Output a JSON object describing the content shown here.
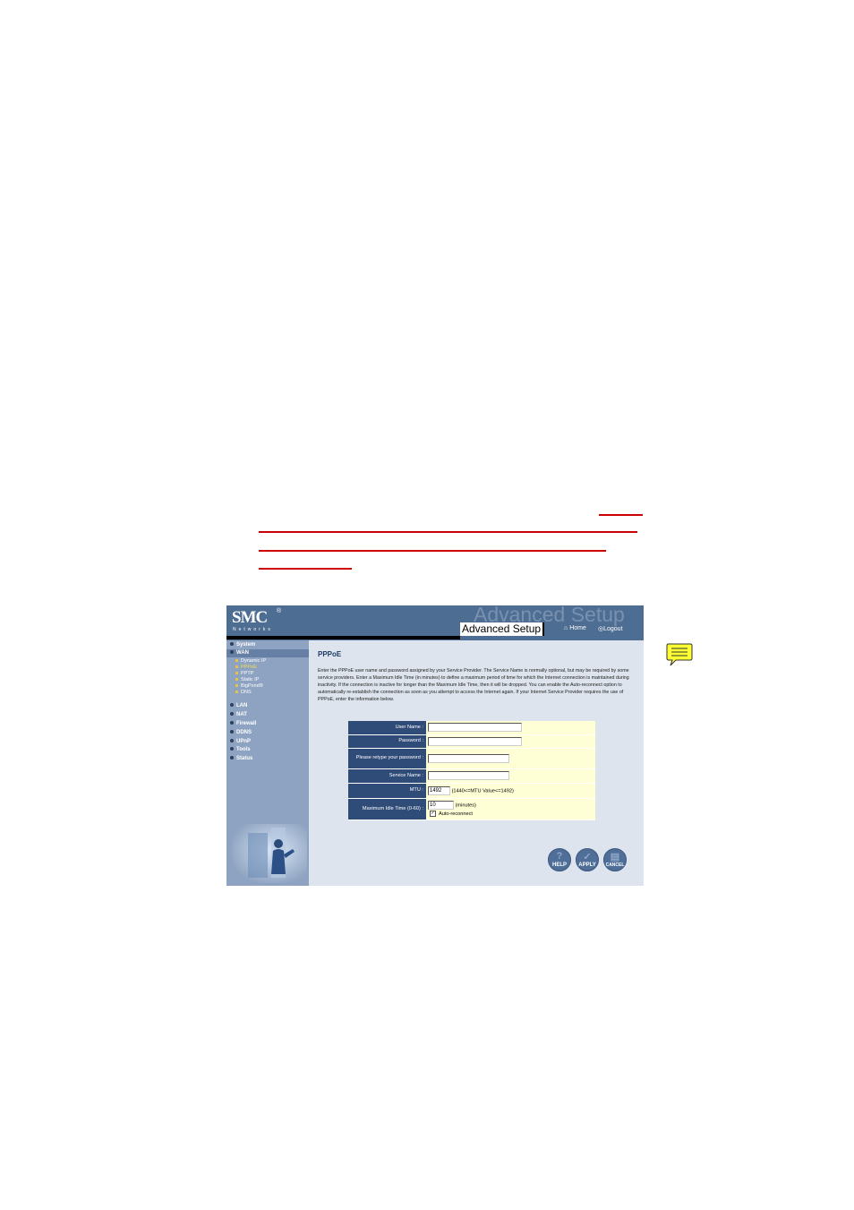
{
  "header": {
    "logo": "SMC",
    "logo_reg": "®",
    "logo_sub": "Networks",
    "watermark": "Advanced Setup",
    "tab_title": "Advanced Setup",
    "home": "Home",
    "logout": "Logout"
  },
  "sidebar": {
    "items": [
      {
        "label": "System"
      },
      {
        "label": "WAN"
      },
      {
        "label": "LAN"
      },
      {
        "label": "NAT"
      },
      {
        "label": "Firewall"
      },
      {
        "label": "DDNS"
      },
      {
        "label": "UPnP"
      },
      {
        "label": "Tools"
      },
      {
        "label": "Status"
      }
    ],
    "wan_sub": [
      {
        "label": "Dynamic IP"
      },
      {
        "label": "PPPoE"
      },
      {
        "label": "PPTP"
      },
      {
        "label": "Static IP"
      },
      {
        "label": "BigPond®"
      },
      {
        "label": "DNS"
      }
    ]
  },
  "main": {
    "title": "PPPoE",
    "description": "Enter the PPPoE user name and password assigned by your Service Provider. The Service Name is normally optional, but may be required by some service providers. Enter a Maximum Idle Time (in minutes) to define a maximum period of time for which the Internet connection is maintained during inactivity. If the connection is inactive for longer than the Maximum Idle Time, then it will be dropped. You can enable the Auto-reconnect option to automatically re-establish the connection as soon as you attempt to access the Internet again. If your Internet Service Provider requires the use of PPPoE, enter the information below.",
    "form": {
      "user_name_label": "User Name :",
      "user_name_value": "",
      "password_label": "Password :",
      "password_value": "",
      "retype_label": "Please retype your password :",
      "retype_value": "",
      "service_label": "Service Name :",
      "service_value": "",
      "mtu_label": "MTU :",
      "mtu_value": "1492",
      "mtu_hint": "(1440<=MTU Value<=1492)",
      "idle_label": "Maximum Idle Time (0-60) :",
      "idle_value": "10",
      "idle_unit": "(minutes)",
      "auto_check": "✓",
      "auto_label": "Auto-reconnect"
    },
    "buttons": {
      "help": "HELP",
      "apply": "APPLY",
      "cancel": "CANCEL"
    }
  },
  "colors": {
    "header": "#4e6d92",
    "sidebar": "#8ea3c1",
    "form_label_bg": "#2f4b78",
    "form_value_bg": "#ffffd6",
    "redline": "#cc0000"
  },
  "icons": [
    "home-icon",
    "logout-icon",
    "help-icon",
    "apply-icon",
    "cancel-icon",
    "comment-icon"
  ]
}
